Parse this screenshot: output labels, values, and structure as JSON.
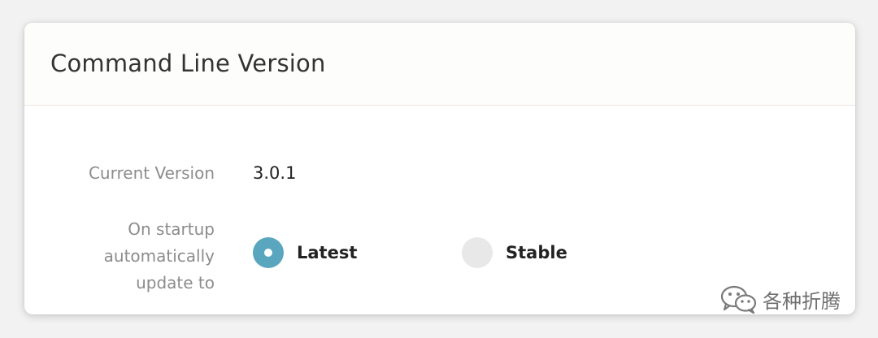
{
  "panel": {
    "title": "Command Line Version"
  },
  "current_version": {
    "label": "Current Version",
    "value": "3.0.1"
  },
  "startup_update": {
    "label": "On startup automatically update to",
    "options": [
      {
        "label": "Latest",
        "selected": true
      },
      {
        "label": "Stable",
        "selected": false
      }
    ],
    "accent_color": "#5ba6bf"
  },
  "watermark": {
    "icon": "wechat-icon",
    "text": "各种折腾"
  }
}
